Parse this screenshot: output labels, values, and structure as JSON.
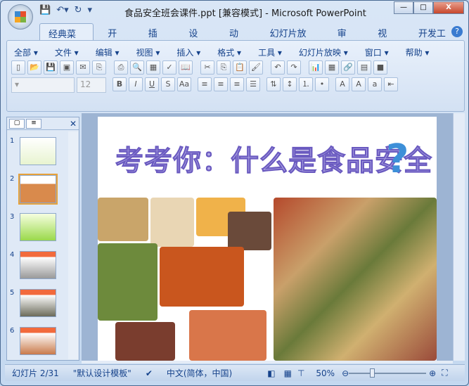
{
  "window": {
    "title": "食品安全班会课件.ppt [兼容模式] - Microsoft PowerPoint",
    "minimize": "—",
    "maximize": "□",
    "close": "X"
  },
  "tabs": [
    "经典菜单",
    "开始",
    "插入",
    "设计",
    "动画",
    "幻灯片放映",
    "审阅",
    "视图",
    "开发工具"
  ],
  "help": "?",
  "menu": [
    "全部 ▾",
    "文件 ▾",
    "编辑 ▾",
    "视图 ▾",
    "插入 ▾",
    "格式 ▾",
    "工具 ▾",
    "幻灯片放映 ▾",
    "窗口 ▾",
    "帮助 ▾"
  ],
  "font_size": "12",
  "format_buttons": [
    "B",
    "I",
    "U",
    "S",
    "Aa"
  ],
  "panel": {
    "close": "✕"
  },
  "thumbnails": [
    "1",
    "2",
    "3",
    "4",
    "5",
    "6"
  ],
  "slide": {
    "title": "考考你：什么是食品安全",
    "icon": "?"
  },
  "status": {
    "slide": "幻灯片 2/31",
    "template": "\"默认设计模板\"",
    "language": "中文(简体，中国)",
    "zoom": "50%"
  }
}
